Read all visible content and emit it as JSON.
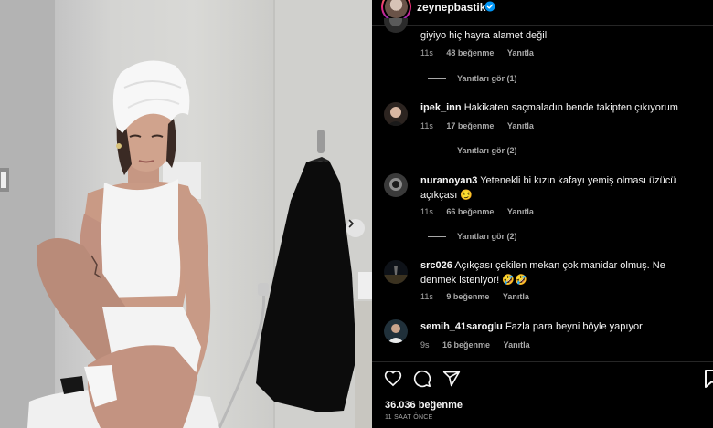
{
  "post": {
    "username": "zeynepbastik",
    "like_count": "36.036 beğenme",
    "time_ago": "11 SAAT ÖNCE"
  },
  "comments": [
    {
      "username": "",
      "text": "giyiyo hiç hayra alamet değil",
      "time": "11s",
      "likes": "48 beğenme",
      "reply": "Yanıtla",
      "view_replies": "Yanıtları gör (1)"
    },
    {
      "username": "ipek_inn",
      "text": "Hakikaten saçmaladın bende takipten çıkıyorum",
      "time": "11s",
      "likes": "17 beğenme",
      "reply": "Yanıtla",
      "view_replies": "Yanıtları gör (2)"
    },
    {
      "username": "nuranoyan3",
      "text": "Yetenekli bi kızın kafayı yemiş olması üzücü açıkçası 😏",
      "time": "11s",
      "likes": "66 beğenme",
      "reply": "Yanıtla",
      "view_replies": "Yanıtları gör (2)"
    },
    {
      "username": "src026",
      "text": "Açıkçası çekilen mekan çok manidar olmuş. Ne denmek isteniyor! 🤣🤣",
      "time": "11s",
      "likes": "9 beğenme",
      "reply": "Yanıtla",
      "view_replies": ""
    },
    {
      "username": "semih_41saroglu",
      "text": "Fazla para beyni böyle yapıyor",
      "time": "9s",
      "likes": "16 beğenme",
      "reply": "Yanıtla",
      "view_replies": ""
    }
  ],
  "icons": {
    "like": "heart-icon",
    "comment": "comment-icon",
    "share": "share-icon",
    "save": "bookmark-icon",
    "verified": "verified-badge-icon",
    "next": "chevron-right-icon"
  },
  "colors": {
    "panel_bg": "#000000",
    "text": "#f5f5f5",
    "secondary_text": "#a8a8a8",
    "verified": "#0095f6"
  }
}
